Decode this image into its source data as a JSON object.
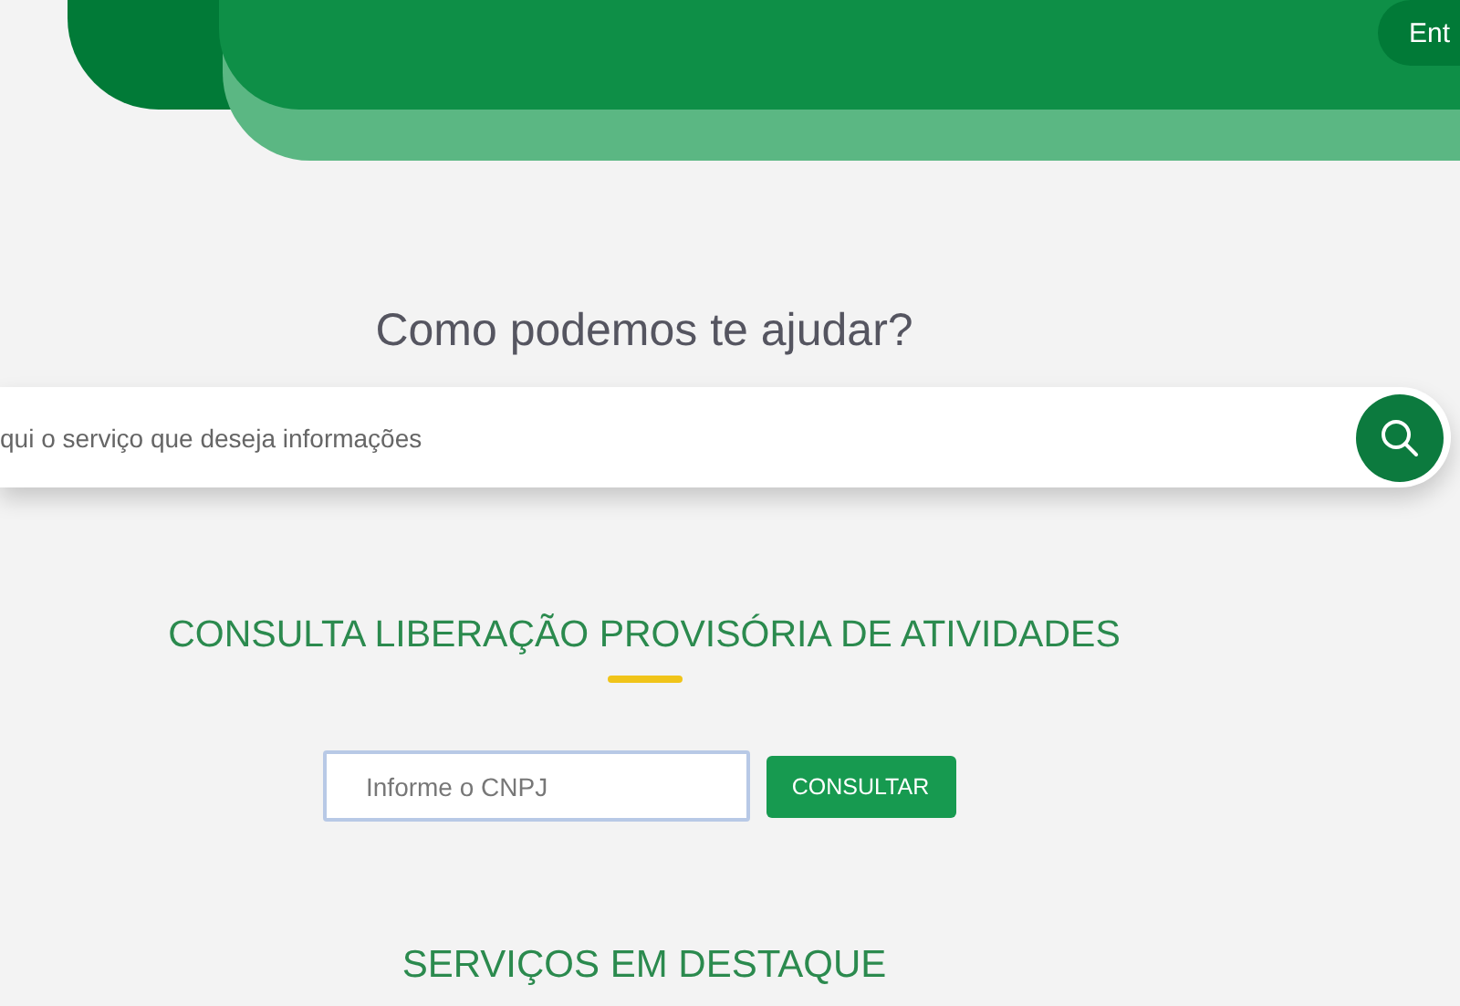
{
  "header": {
    "button": "Ent"
  },
  "help": {
    "title": "Como podemos te ajudar?",
    "search_placeholder": "qui o serviço que deseja informações"
  },
  "consulta": {
    "title": "CONSULTA LIBERAÇÃO PROVISÓRIA DE ATIVIDADES",
    "input_placeholder": "Informe o CNPJ",
    "button": "CONSULTAR"
  },
  "destaque": {
    "title": "SERVIÇOS EM DESTAQUE"
  }
}
